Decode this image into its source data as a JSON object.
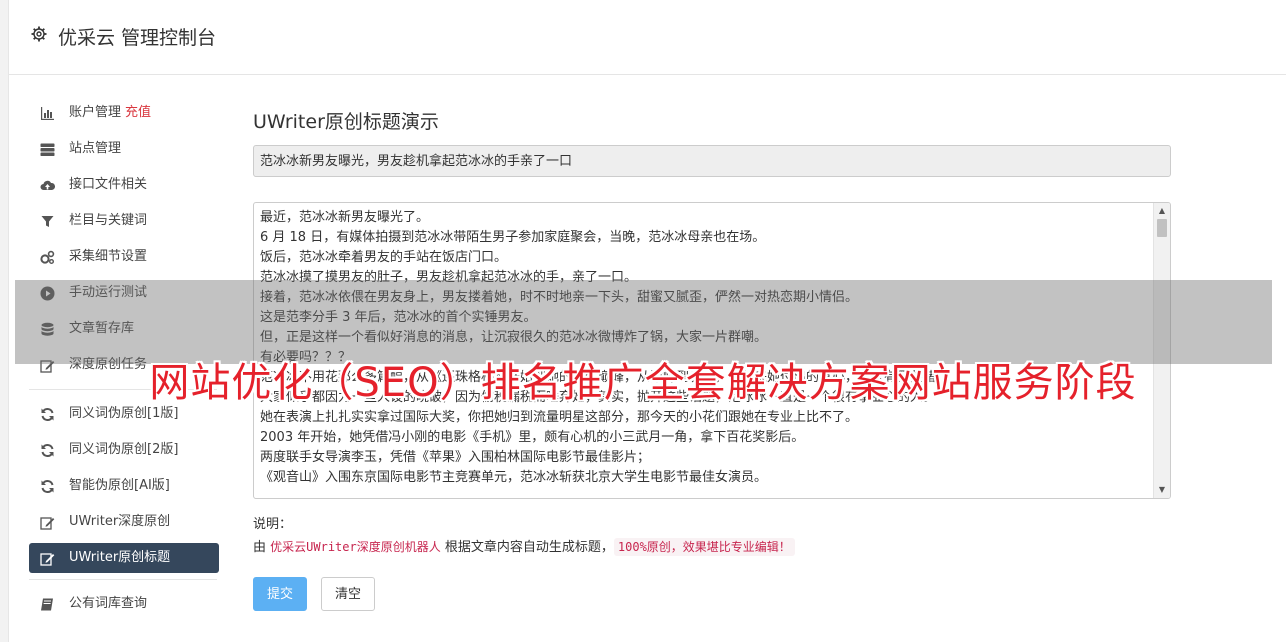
{
  "header": {
    "title": "优采云 管理控制台"
  },
  "sidebar": {
    "items": [
      {
        "label": "账户管理",
        "extra": "充值",
        "icon": "bar-chart-icon"
      },
      {
        "label": "站点管理",
        "icon": "server-icon"
      },
      {
        "label": "接口文件相关",
        "icon": "cloud-upload-icon"
      },
      {
        "label": "栏目与关键词",
        "icon": "filter-icon"
      },
      {
        "label": "采集细节设置",
        "icon": "gears-icon"
      },
      {
        "label": "手动运行测试",
        "icon": "play-circle-icon"
      },
      {
        "label": "文章暂存库",
        "icon": "database-icon"
      },
      {
        "label": "深度原创任务",
        "icon": "edit-icon"
      },
      {
        "label": "同义词伪原创[1版]",
        "icon": "refresh-icon"
      },
      {
        "label": "同义词伪原创[2版]",
        "icon": "refresh-icon"
      },
      {
        "label": "智能伪原创[AI版]",
        "icon": "refresh-icon"
      },
      {
        "label": "UWriter深度原创",
        "icon": "edit-icon"
      },
      {
        "label": "UWriter原创标题",
        "icon": "edit-icon",
        "active": true
      },
      {
        "label": "公有词库查询",
        "icon": "book-icon"
      }
    ]
  },
  "main": {
    "title": "UWriter原创标题演示",
    "title_value": "范冰冰新男友曝光，男友趁机拿起范冰冰的手亲了一口",
    "content_lines": [
      "最近，范冰冰新男友曝光了。",
      "6 月 18 日，有媒体拍摄到范冰冰带陌生男子参加家庭聚会，当晚，范冰冰母亲也在场。",
      "饭后，范冰冰牵着男友的手站在饭店门口。",
      "范冰冰摸了摸男友的肚子，男友趁机拿起范冰冰的手，亲了一口。",
      "接着，范冰冰依偎在男友身上，男友搂着她，时不时地亲一下头，甜蜜又腻歪，俨然一对热恋期小情侣。",
      "这是范李分手 3 年后，范冰冰的首个实锤男友。",
      "但，正是这样一个看似好消息的消息，让沉寂很久的范冰冰微博炸了锅，大家一片群嘲。",
      "有必要吗？？？",
      "范冰冰不用花那么多篇幅，从《还珠格格》开始到她的人生巅峰，从巅峰到谷底，多年来她付出的真心，大家有目共睹。",
      "大家似乎都因为一些人设的晓破，因为偷税漏税而唾弃她，其实，抛开这些话题，范冰冰一直是一个很有事业心的人。",
      "她在表演上扎扎实实拿过国际大奖，你把她归到流量明星这部分，那今天的小花们跟她在专业上比不了。",
      "2003 年开始，她凭借冯小刚的电影《手机》里，颇有心机的小三武月一角，拿下百花奖影后。",
      "两度联手女导演李玉，凭借《苹果》入围柏林国际电影节最佳影片；",
      "《观音山》入围东京国际电影节主竞赛单元，范冰冰斩获北京大学生电影节最佳女演员。"
    ],
    "note_label": "说明：",
    "note_prefix": "由",
    "note_highlight": "优采云UWriter深度原创机器人",
    "note_middle": "根据文章内容自动生成标题，",
    "note_badge": "100%原创，效果堪比专业编辑！",
    "submit_label": "提交",
    "clear_label": "清空"
  },
  "overlay": {
    "text": "网站优化（SEO）排名推广全套解决方案网站服务阶段"
  },
  "colors": {
    "accent_red": "#d9363e",
    "active_bg": "#35475c",
    "submit_bg": "#5cb0f3"
  }
}
